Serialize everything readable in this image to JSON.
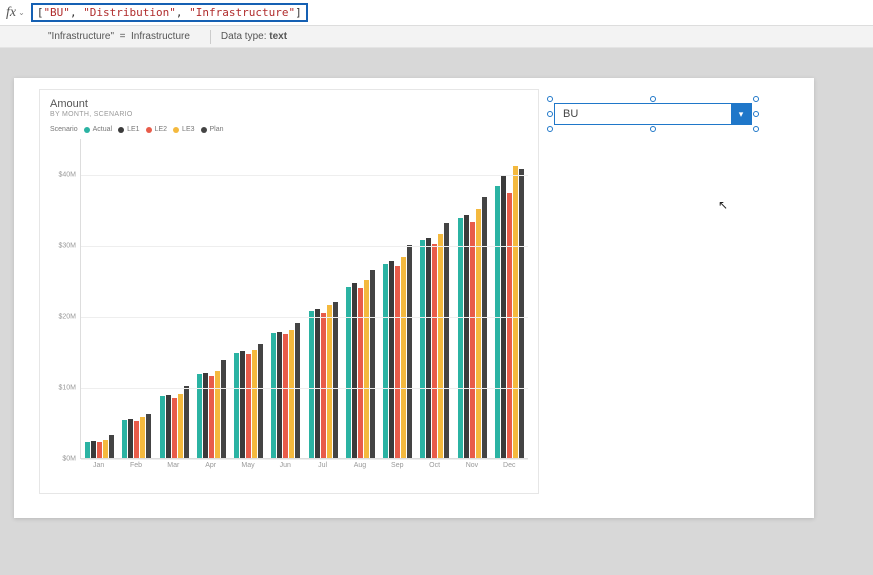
{
  "formula_bar": {
    "fx_label": "fx",
    "expr_open": "[",
    "expr_vals": [
      "\"BU\"",
      "\"Distribution\"",
      "\"Infrastructure\""
    ],
    "expr_close": "]"
  },
  "info_bar": {
    "left_quoted": "\"Infrastructure\"",
    "eq": "=",
    "left_val": "Infrastructure",
    "datatype_label": "Data type:",
    "datatype_value": "text"
  },
  "dropdown": {
    "selected": "BU"
  },
  "chart_data": {
    "type": "bar",
    "title": "Amount",
    "subtitle": "BY MONTH, SCENARIO",
    "legend_label": "Scenario",
    "xlabel": "",
    "ylabel": "",
    "ylim": [
      0,
      45000000
    ],
    "y_ticks": [
      {
        "v": 0,
        "label": "$0M"
      },
      {
        "v": 10000000,
        "label": "$10M"
      },
      {
        "v": 20000000,
        "label": "$20M"
      },
      {
        "v": 30000000,
        "label": "$30M"
      },
      {
        "v": 40000000,
        "label": "$40M"
      }
    ],
    "categories": [
      "Jan",
      "Feb",
      "Mar",
      "Apr",
      "May",
      "Jun",
      "Jul",
      "Aug",
      "Sep",
      "Oct",
      "Nov",
      "Dec"
    ],
    "series": [
      {
        "name": "Actual",
        "color": "#2bb3a3",
        "values": [
          2300000,
          5300000,
          8700000,
          11800000,
          14800000,
          17600000,
          20700000,
          24100000,
          27300000,
          30600000,
          33800000,
          38200000
        ]
      },
      {
        "name": "LE1",
        "color": "#3b3b3b",
        "values": [
          2400000,
          5500000,
          8800000,
          12000000,
          15000000,
          17700000,
          21000000,
          24600000,
          27700000,
          31000000,
          34200000,
          39600000
        ]
      },
      {
        "name": "LE2",
        "color": "#e85c4a",
        "values": [
          2300000,
          5200000,
          8400000,
          11600000,
          14600000,
          17400000,
          20400000,
          23900000,
          27000000,
          30100000,
          33200000,
          37200000
        ]
      },
      {
        "name": "LE3",
        "color": "#f4b93e",
        "values": [
          2600000,
          5700000,
          9000000,
          12200000,
          15200000,
          18000000,
          21500000,
          25100000,
          28200000,
          31500000,
          35000000,
          41000000
        ]
      },
      {
        "name": "Plan",
        "color": "#444444",
        "values": [
          3300000,
          6200000,
          10100000,
          13800000,
          16000000,
          19000000,
          22000000,
          26500000,
          29900000,
          33000000,
          36700000,
          40600000
        ]
      }
    ]
  }
}
